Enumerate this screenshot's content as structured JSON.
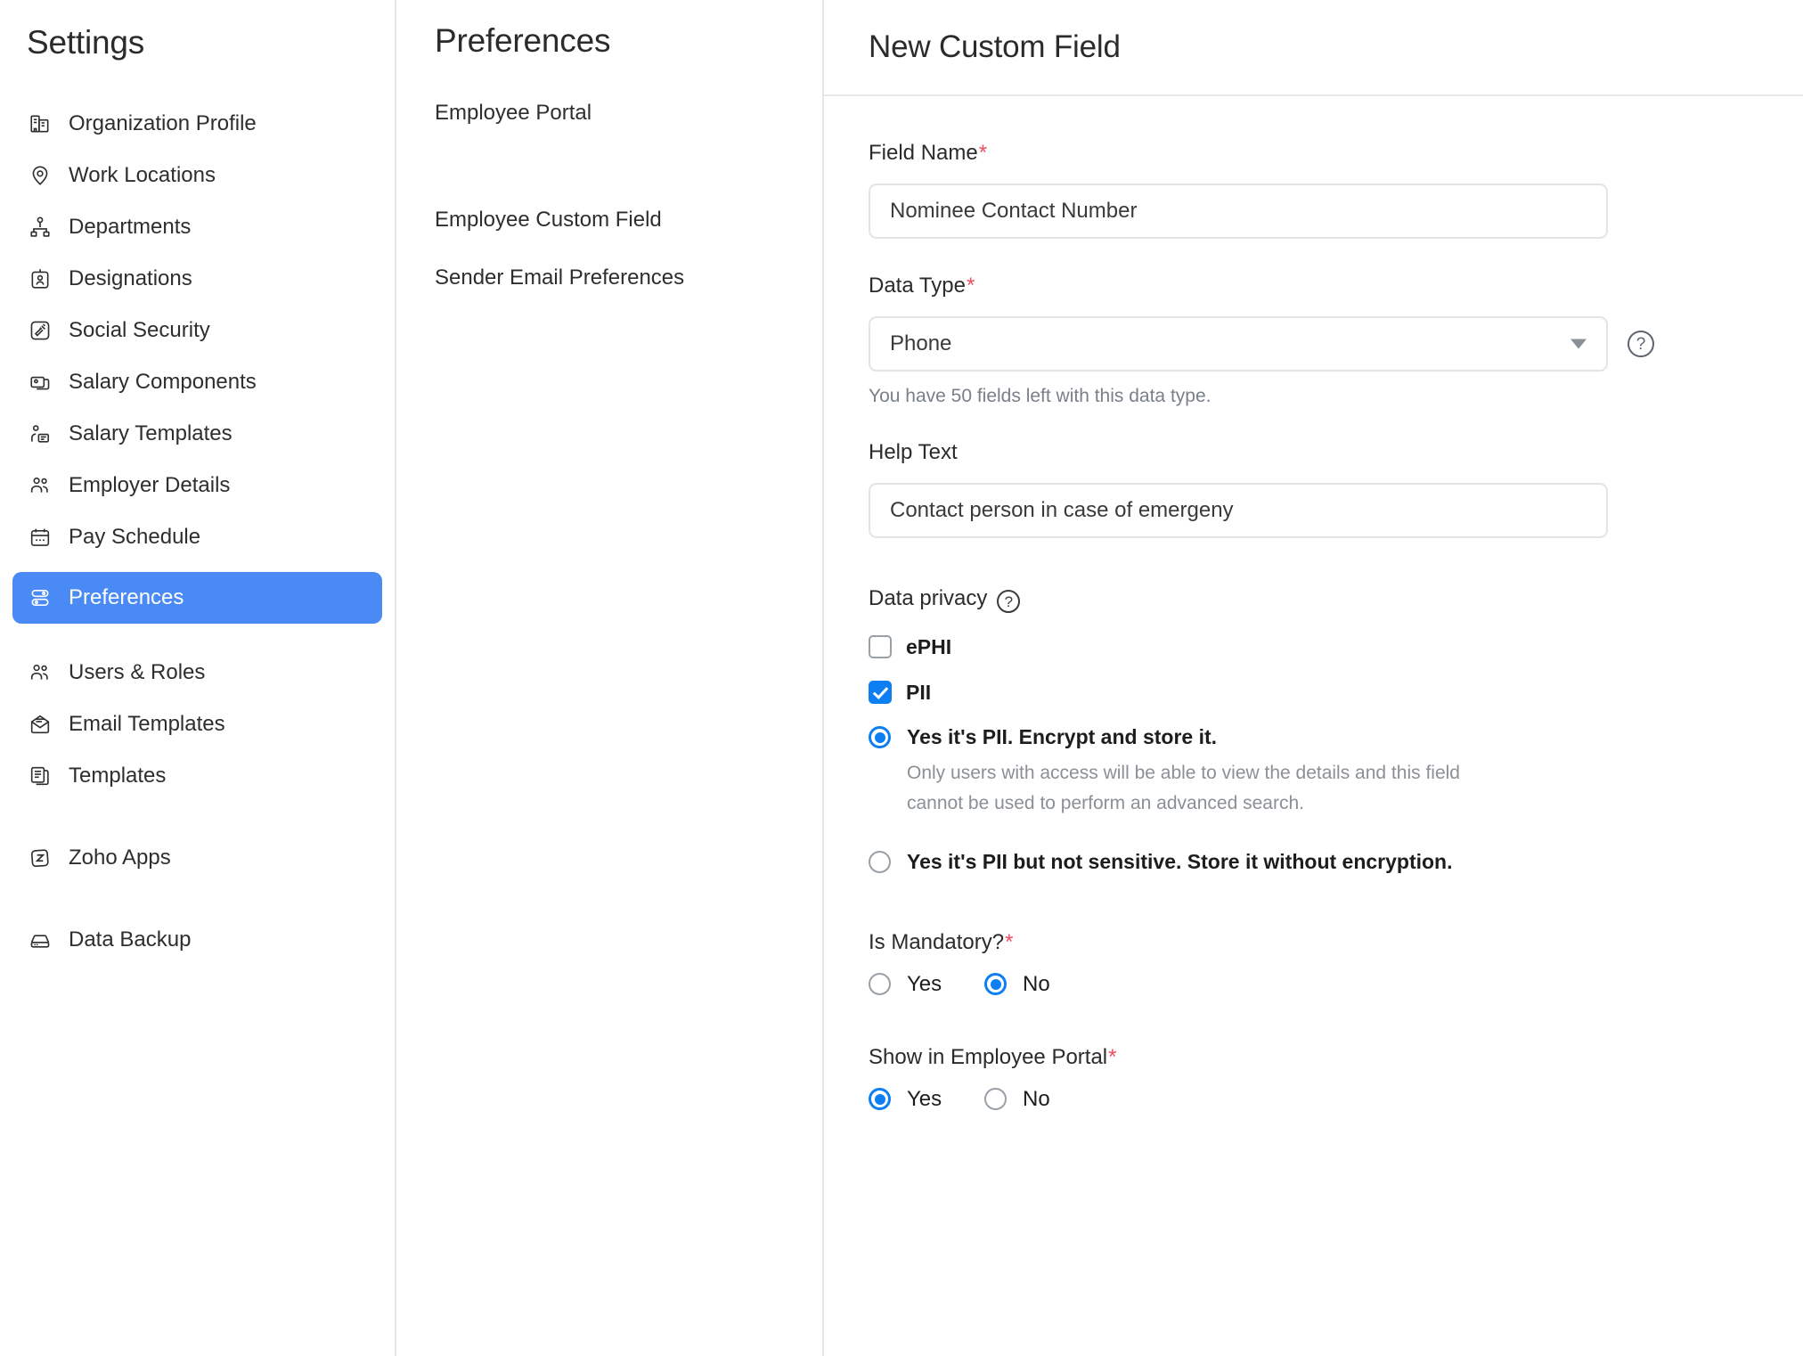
{
  "settings": {
    "title": "Settings",
    "items": [
      {
        "label": "Organization Profile",
        "icon": "building-icon"
      },
      {
        "label": "Work Locations",
        "icon": "map-pin-icon"
      },
      {
        "label": "Departments",
        "icon": "org-chart-icon"
      },
      {
        "label": "Designations",
        "icon": "id-badge-icon"
      },
      {
        "label": "Social Security",
        "icon": "gavel-icon"
      },
      {
        "label": "Salary Components",
        "icon": "cards-icon"
      },
      {
        "label": "Salary Templates",
        "icon": "person-document-icon"
      },
      {
        "label": "Employer Details",
        "icon": "people-icon"
      },
      {
        "label": "Pay Schedule",
        "icon": "calendar-icon"
      },
      {
        "label": "Preferences",
        "icon": "sliders-icon",
        "active": true
      },
      {
        "label": "Users & Roles",
        "icon": "people-icon"
      },
      {
        "label": "Email Templates",
        "icon": "envelope-icon"
      },
      {
        "label": "Templates",
        "icon": "documents-icon"
      },
      {
        "label": "Zoho Apps",
        "icon": "zoho-icon"
      },
      {
        "label": "Data Backup",
        "icon": "drive-icon"
      }
    ]
  },
  "preferences": {
    "title": "Preferences",
    "items": [
      {
        "label": "Employee Portal"
      },
      {
        "label": "Employee Custom Field"
      },
      {
        "label": "Sender Email Preferences"
      }
    ]
  },
  "form": {
    "title": "New Custom Field",
    "field_name": {
      "label": "Field Name",
      "required": "*",
      "value": "Nominee Contact Number",
      "placeholder": "Nominee Contact Number"
    },
    "data_type": {
      "label": "Data Type",
      "required": "*",
      "value": "Phone",
      "help_icon": "?",
      "note": "You have 50 fields left with this data type."
    },
    "help_text": {
      "label": "Help Text",
      "value": "Contact person in case of emergeny",
      "placeholder": "Contact person in case of emergeny"
    },
    "data_privacy": {
      "label": "Data privacy",
      "help_icon": "?",
      "checkboxes": [
        {
          "label": "ePHI",
          "checked": false
        },
        {
          "label": "PII",
          "checked": true
        }
      ],
      "radios": [
        {
          "label": "Yes it's PII. Encrypt and store it.",
          "selected": true,
          "description": "Only users with access will be able to view the details and this field cannot be used to perform an advanced search."
        },
        {
          "label": "Yes it's PII but not sensitive. Store it without encryption.",
          "selected": false,
          "description": ""
        }
      ]
    },
    "is_mandatory": {
      "label": "Is Mandatory?",
      "required": "*",
      "options": [
        {
          "label": "Yes",
          "selected": false
        },
        {
          "label": "No",
          "selected": true
        }
      ]
    },
    "show_in_portal": {
      "label": "Show in Employee Portal",
      "required": "*",
      "options": [
        {
          "label": "Yes",
          "selected": true
        },
        {
          "label": "No",
          "selected": false
        }
      ]
    }
  },
  "colors": {
    "accent_blue": "#4a8af4",
    "control_blue": "#0d7ff2",
    "required_red": "#f04b5e",
    "muted_text": "#8a9096"
  }
}
